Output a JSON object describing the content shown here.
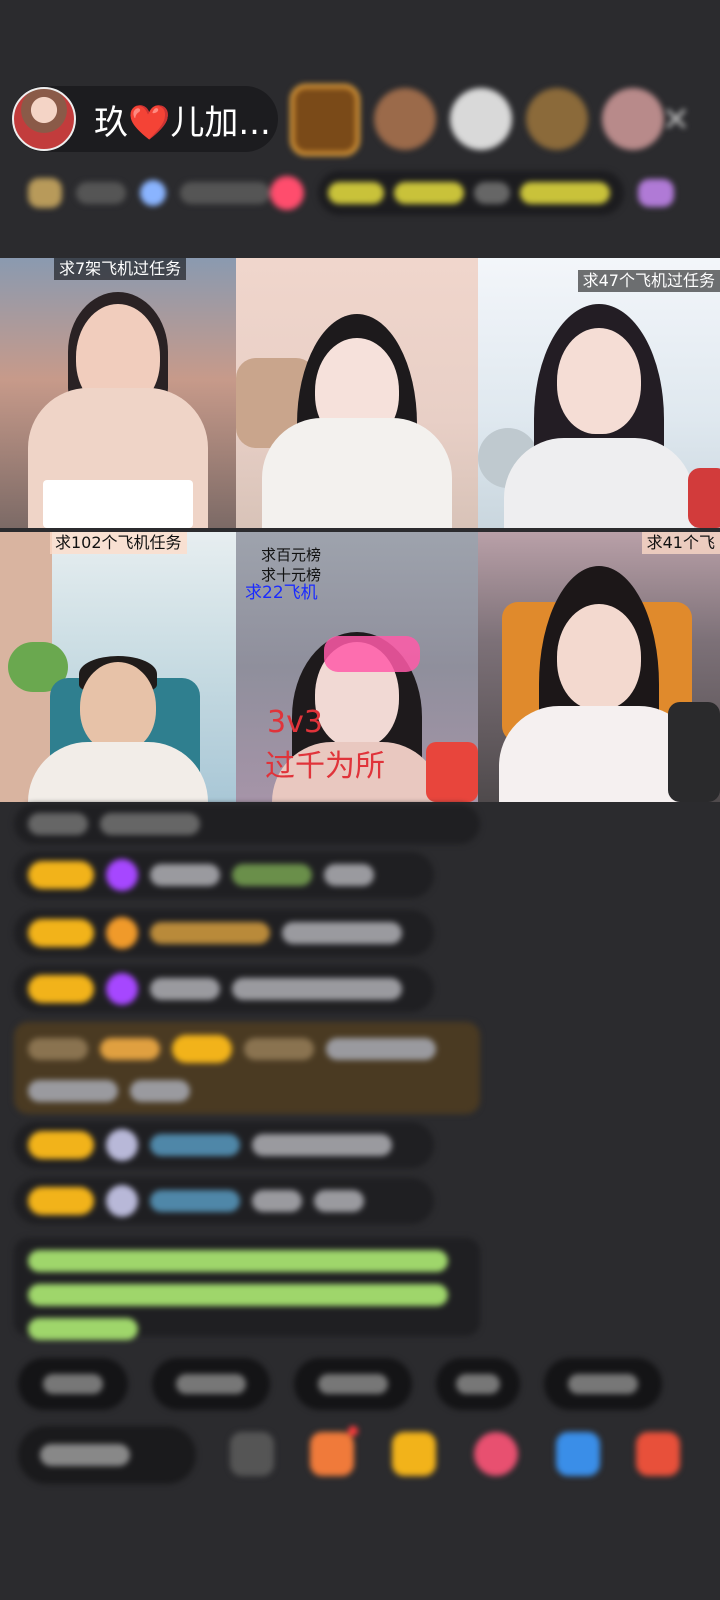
{
  "host": {
    "name": "玖❤️儿加..."
  },
  "header": {
    "close_icon": "close-icon"
  },
  "grid": {
    "tiles": [
      {
        "tags": [
          "求7架飞机过任务"
        ]
      },
      {
        "tags": []
      },
      {
        "tags": [
          "求47个飞机过任务"
        ]
      },
      {
        "tags": [
          "求102个飞机任务"
        ]
      },
      {
        "tags": [
          "求百元榜",
          "求十元榜",
          "求22飞机",
          "3v3",
          "过千为所"
        ]
      },
      {
        "tags": [
          "求41个飞"
        ]
      }
    ]
  },
  "colors": {
    "background": "#2b2b2e",
    "chat_pill": "#1f1f22",
    "badge_gold": "#f2b31a",
    "gem_purple": "#a647ff",
    "welcome_green": "#9fd66b"
  }
}
